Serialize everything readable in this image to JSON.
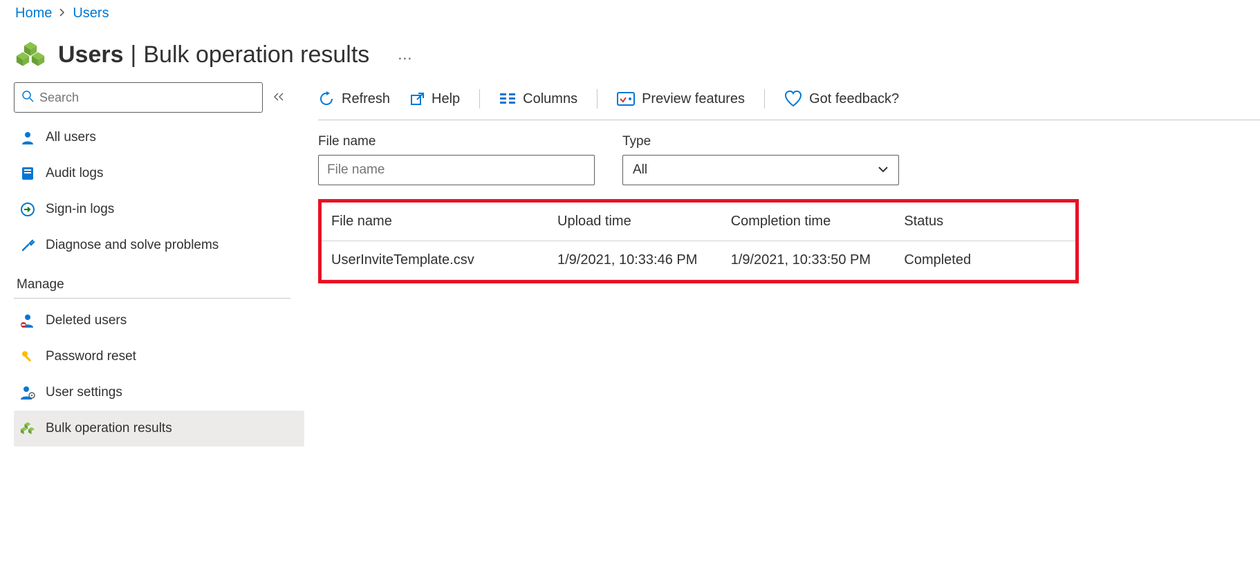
{
  "breadcrumb": {
    "home": "Home",
    "users": "Users"
  },
  "header": {
    "title_bold": "Users",
    "title_rest": "Bulk operation results"
  },
  "search": {
    "placeholder": "Search"
  },
  "sidebar": {
    "items": [
      {
        "label": "All users"
      },
      {
        "label": "Audit logs"
      },
      {
        "label": "Sign-in logs"
      },
      {
        "label": "Diagnose and solve problems"
      }
    ],
    "manage_label": "Manage",
    "manage_items": [
      {
        "label": "Deleted users"
      },
      {
        "label": "Password reset"
      },
      {
        "label": "User settings"
      },
      {
        "label": "Bulk operation results"
      }
    ]
  },
  "toolbar": {
    "refresh": "Refresh",
    "help": "Help",
    "columns": "Columns",
    "preview": "Preview features",
    "feedback": "Got feedback?"
  },
  "filters": {
    "file_label": "File name",
    "file_placeholder": "File name",
    "type_label": "Type",
    "type_value": "All"
  },
  "table": {
    "headers": {
      "file": "File name",
      "upload": "Upload time",
      "completion": "Completion time",
      "status": "Status"
    },
    "rows": [
      {
        "file": "UserInviteTemplate.csv",
        "upload": "1/9/2021, 10:33:46 PM",
        "completion": "1/9/2021, 10:33:50 PM",
        "status": "Completed"
      }
    ]
  }
}
